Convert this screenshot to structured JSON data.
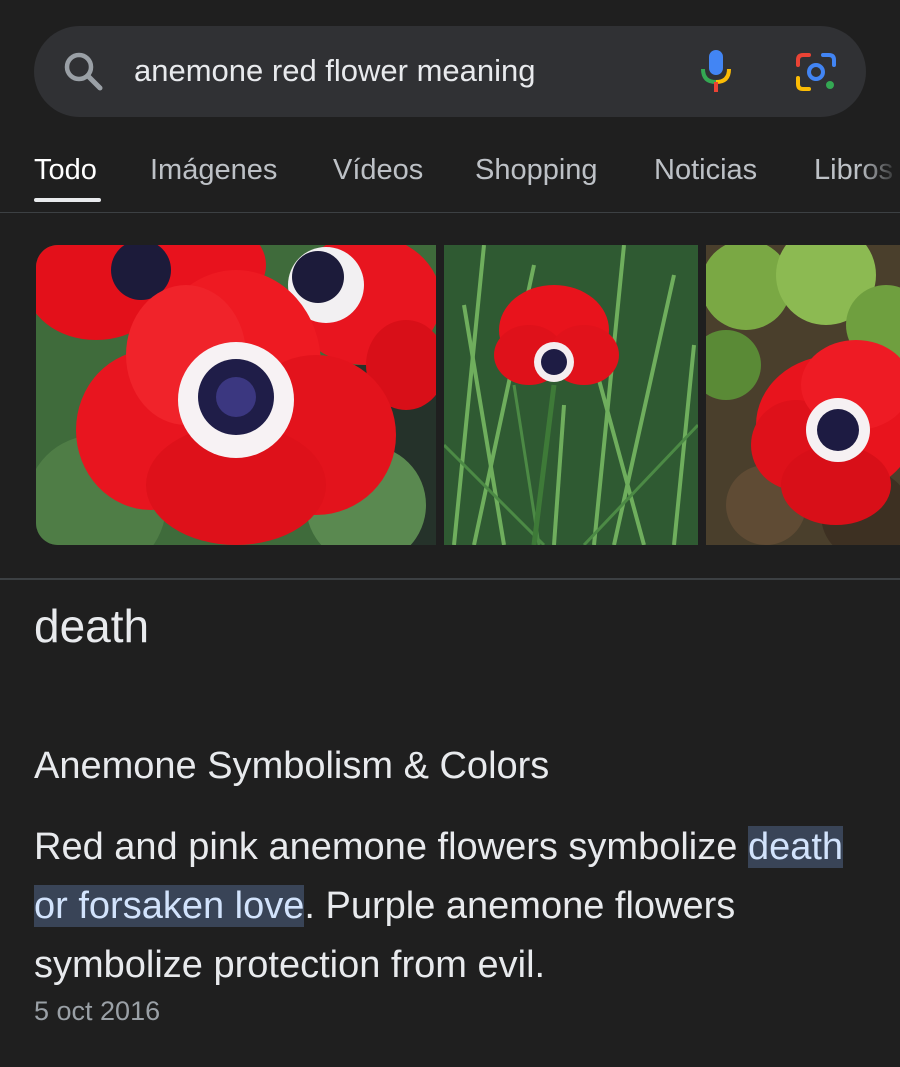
{
  "search": {
    "query": "anemone red flower meaning",
    "icons": [
      "search-icon",
      "mic-icon",
      "lens-icon"
    ]
  },
  "tabs": [
    {
      "label": "Todo",
      "active": true
    },
    {
      "label": "Imágenes"
    },
    {
      "label": "Vídeos"
    },
    {
      "label": "Shopping"
    },
    {
      "label": "Noticias"
    },
    {
      "label": "Libros"
    }
  ],
  "images": [
    "red-anemone-closeup",
    "red-anemone-in-grass",
    "red-anemone-on-foliage"
  ],
  "result": {
    "answer": "death",
    "heading": "Anemone Symbolism & Colors",
    "snippet_before": "Red and pink anemone flowers symbolize ",
    "snippet_highlight": "death or forsaken love",
    "snippet_after": ". Purple anemone flowers symbolize protection from evil.",
    "date": "5 oct 2016"
  },
  "colors": {
    "background": "#1f1f1f",
    "search_bar": "#303134",
    "text": "#e8eaed",
    "highlight": "#394457"
  }
}
